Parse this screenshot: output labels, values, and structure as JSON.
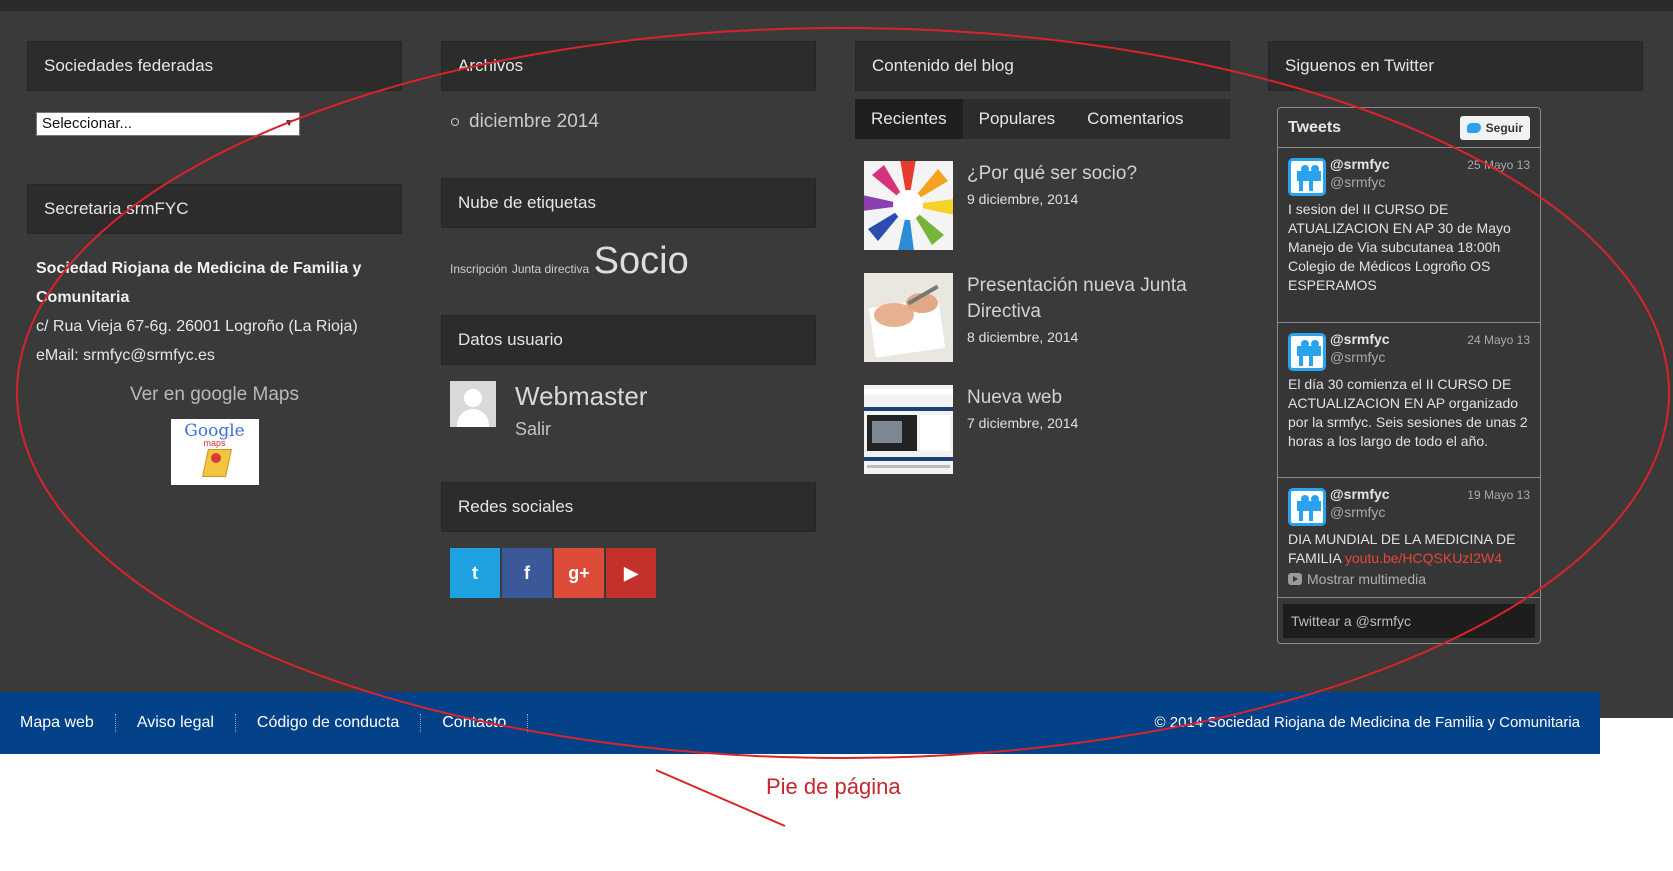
{
  "col1": {
    "federadas_title": "Sociedades federadas",
    "select_value": "Seleccionar...",
    "secretaria_title": "Secretaria srmFYC",
    "org_name": "Sociedad Riojana de Medicina de Familia y Comunitaria",
    "address": "c/ Rua Vieja 67-6g. 26001 Logroño (La Rioja)",
    "email": "eMail: srmfyc@srmfyc.es",
    "maps_link": "Ver en google Maps",
    "maps_logo_text": "Google",
    "maps_logo_sub": "maps"
  },
  "col2": {
    "archivos_title": "Archivos",
    "archive_item": "diciembre 2014",
    "nube_title": "Nube de etiquetas",
    "tags": [
      "Inscripción",
      "Junta directiva",
      "Socio"
    ],
    "datos_title": "Datos usuario",
    "user_name": "Webmaster",
    "logout": "Salir",
    "redes_title": "Redes sociales",
    "social": [
      {
        "icon": "twitter-icon",
        "glyph": "t",
        "color": "#1da1e0"
      },
      {
        "icon": "facebook-icon",
        "glyph": "f",
        "color": "#3b5998"
      },
      {
        "icon": "google-plus-icon",
        "glyph": "g+",
        "color": "#dd4b39"
      },
      {
        "icon": "youtube-icon",
        "glyph": "▶",
        "color": "#c4302b"
      }
    ]
  },
  "col3": {
    "blog_title": "Contenido del blog",
    "tabs": [
      "Recientes",
      "Populares",
      "Comentarios"
    ],
    "posts": [
      {
        "title": "¿Por qué ser socio?",
        "date": "9 diciembre, 2014"
      },
      {
        "title": "Presentación nueva Junta Directiva",
        "date": "8 diciembre, 2014"
      },
      {
        "title": "Nueva web",
        "date": "7 diciembre, 2014"
      }
    ]
  },
  "col4": {
    "twitter_title": "Siguenos en Twitter",
    "tweets_label": "Tweets",
    "follow_label": "Seguir",
    "tweets": [
      {
        "handle": "@srmfyc",
        "sub": "@srmfyc",
        "date": "25 Mayo 13",
        "text": "I sesion del II CURSO DE ATUALIZACION EN AP  30 de Mayo Manejo de Via subcutanea 18:00h Colegio de Médicos Logroño OS ESPERAMOS"
      },
      {
        "handle": "@srmfyc",
        "sub": "@srmfyc",
        "date": "24 Mayo 13",
        "text": "El día 30 comienza el II CURSO DE ACTUALIZACION EN AP organizado por la srmfyc. Seis sesiones de unas 2 horas a los largo de todo el año."
      },
      {
        "handle": "@srmfyc",
        "sub": "@srmfyc",
        "date": "19 Mayo 13",
        "text": "DIA MUNDIAL DE LA MEDICINA DE FAMILIA ",
        "link": "youtu.be/HCQSKUzI2W4",
        "media": "Mostrar multimedia"
      }
    ],
    "compose_placeholder": "Twittear a @srmfyc"
  },
  "footer": {
    "links": [
      "Mapa web",
      "Aviso legal",
      "Código de conducta",
      "Contacto"
    ],
    "copyright": "© 2014 Sociedad Riojana de Medicina de Familia y Comunitaria"
  },
  "annotation": {
    "label": "Pie de página",
    "color": "#c8242c"
  }
}
